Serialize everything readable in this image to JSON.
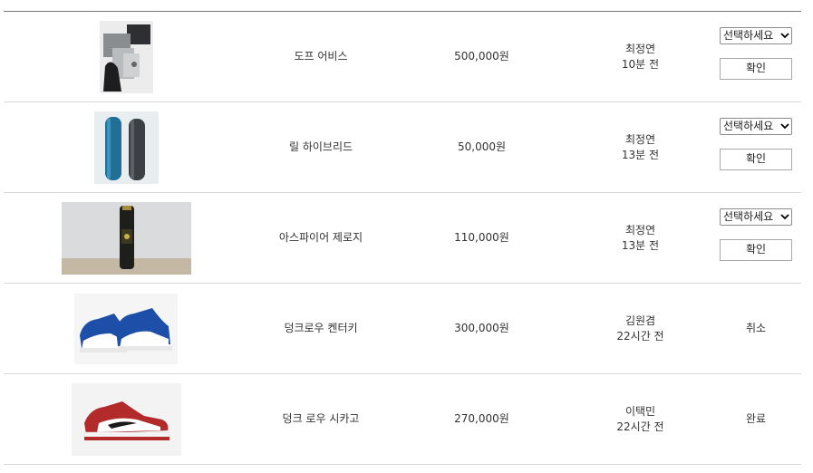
{
  "rows": [
    {
      "image_icon": "metal-cube-product-photo",
      "name": "도프 어비스",
      "price": "500,000원",
      "user": "최정연",
      "time": "10분 전",
      "select_value": "선택하세요",
      "confirm_label": "확인"
    },
    {
      "image_icon": "two-tubes-product-photo",
      "name": "릴 하이브리드",
      "price": "50,000원",
      "user": "최정연",
      "time": "13분 전",
      "select_value": "선택하세요",
      "confirm_label": "확인"
    },
    {
      "image_icon": "tall-bottle-product-photo",
      "name": "아스파이어 제로지",
      "price": "110,000원",
      "user": "최정연",
      "time": "13분 전",
      "select_value": "선택하세요",
      "confirm_label": "확인"
    },
    {
      "image_icon": "blue-sneaker-product-photo",
      "name": "덩크로우 켄터키",
      "price": "300,000원",
      "user": "김원겸",
      "time": "22시간 전",
      "status": "취소"
    },
    {
      "image_icon": "red-sneaker-product-photo",
      "name": "덩크 로우 시카고",
      "price": "270,000원",
      "user": "이택민",
      "time": "22시간 전",
      "status": "완료"
    }
  ]
}
